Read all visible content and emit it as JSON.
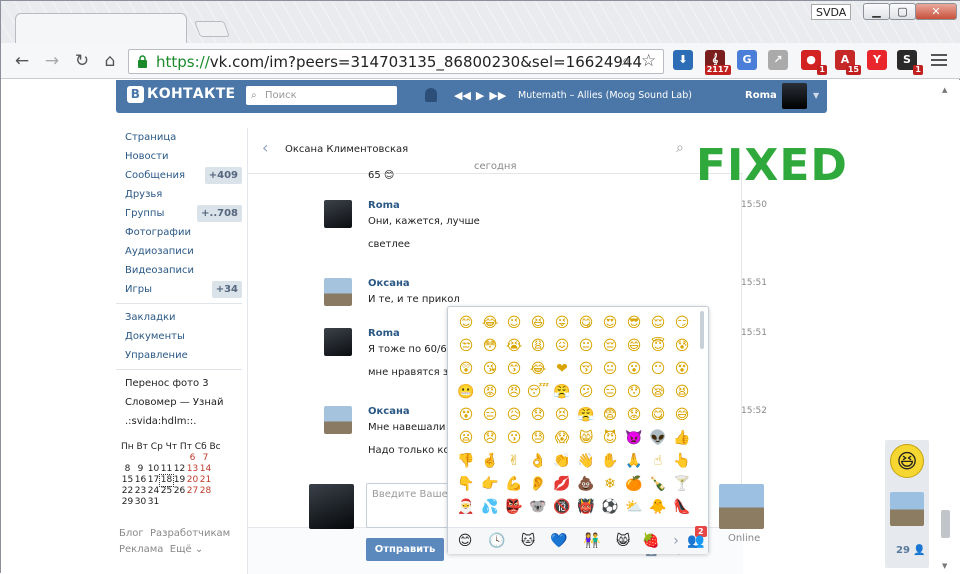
{
  "window": {
    "title": "SVDA",
    "min_label": "▁",
    "max_label": "▢",
    "close_label": "✕"
  },
  "browser": {
    "url_scheme": "https://",
    "url_rest": "vk.com/im?peers=314703135_86800230&sel=16624944",
    "extensions": [
      {
        "name": "download-ext",
        "label": "⬇",
        "color": "#2d6db5",
        "badge": ""
      },
      {
        "name": "music-ext",
        "label": "𝄞",
        "color": "#7a1d1d",
        "badge": "2117"
      },
      {
        "name": "translate-ext",
        "label": "G",
        "color": "#4a7ed8",
        "badge": ""
      },
      {
        "name": "share-ext",
        "label": "↗",
        "color": "#aaaaaa",
        "badge": ""
      },
      {
        "name": "adblock-ext",
        "label": "●",
        "color": "#d22222",
        "badge": "1"
      },
      {
        "name": "abp-ext",
        "label": "A",
        "color": "#c62828",
        "badge": "15"
      },
      {
        "name": "yandex-ext",
        "label": "Y",
        "color": "#e8262c",
        "badge": ""
      },
      {
        "name": "s-ext",
        "label": "S",
        "color": "#2a2a2a",
        "badge": "1"
      }
    ]
  },
  "vk": {
    "logo_b": "В",
    "logo_text": "КОНТАКТЕ",
    "search_placeholder": "Поиск",
    "track": "Mutemath – Allies (Moog Sound Lab)",
    "user": "Roma",
    "menu": [
      {
        "label": "Страница",
        "count": ""
      },
      {
        "label": "Новости",
        "count": ""
      },
      {
        "label": "Сообщения",
        "count": "+409"
      },
      {
        "label": "Друзья",
        "count": ""
      },
      {
        "label": "Группы",
        "count": "+..708"
      },
      {
        "label": "Фотографии",
        "count": ""
      },
      {
        "label": "Аудиозаписи",
        "count": ""
      },
      {
        "label": "Видеозаписи",
        "count": ""
      },
      {
        "label": "Игры",
        "count": "+34"
      }
    ],
    "menu2": [
      "Закладки",
      "Документы",
      "Управление"
    ],
    "menu3": [
      "Перенос фото 3",
      "Словомер — Узнай",
      ".:svida:hdlm::."
    ],
    "calendar": {
      "header": "Пн Вт Ср Чт Пт Сб Вс",
      "rows": [
        [
          "",
          "",
          "",
          "",
          "",
          "6",
          "7"
        ],
        [
          "8",
          "9",
          "10",
          "11",
          "12",
          "13",
          "14"
        ],
        [
          "15",
          "16",
          "17",
          "18",
          "19",
          "20",
          "21"
        ],
        [
          "22",
          "23",
          "24",
          "25",
          "26",
          "27",
          "28"
        ],
        [
          "29",
          "30",
          "31",
          "",
          "",
          "",
          ""
        ]
      ]
    },
    "footer": [
      "Блог",
      "Разработчикам",
      "Реклама",
      "Ещё ⌄"
    ]
  },
  "conversation": {
    "title": "Оксана Климентовская",
    "date_divider": "сегодня",
    "prev_tail": "65 😊",
    "messages": [
      {
        "author": "Roma",
        "time": "15:50",
        "lines": [
          "Они, кажется, лучше",
          "светлее"
        ]
      },
      {
        "author": "Оксана",
        "time": "15:51",
        "lines": [
          "И те, и те прикол"
        ]
      },
      {
        "author": "Roma",
        "time": "15:51",
        "lines": [
          "Я тоже по 60/65 п",
          "мне нравятся зел"
        ]
      },
      {
        "author": "Оксана",
        "time": "15:52",
        "lines": [
          "Мне навешали ла",
          "Надо только коти"
        ]
      }
    ],
    "input_placeholder": "Введите Ваше сообщение...",
    "send_label": "Отправить",
    "online_label": "Online",
    "more_label": "Ещё ⌄",
    "quick_emoji": [
      "😏",
      "😄",
      "👍",
      "😊",
      "🙈",
      "👫",
      "🎁"
    ]
  },
  "emoji_panel": {
    "rows": [
      [
        "😊",
        "😂",
        "😉",
        "😆",
        "😜",
        "😋",
        "😍",
        "😎",
        "😌",
        "😏"
      ],
      [
        "😒",
        "😳",
        "😭",
        "😩",
        "😖",
        "😐",
        "😔",
        "😄",
        "😇",
        "😰"
      ],
      [
        "😲",
        "😘",
        "😙",
        "😂",
        "❤",
        "😚",
        "😐",
        "😮",
        "😶",
        "😵"
      ],
      [
        "😬",
        "😡",
        "😠",
        "😴",
        "😤",
        "😕",
        "😑",
        "😯",
        "😪",
        "😫"
      ],
      [
        "😵",
        "😑",
        "😥",
        "😞",
        "😣",
        "😤",
        "😨",
        "😟",
        "😋",
        "😅"
      ],
      [
        "😦",
        "😞",
        "😗",
        "😓",
        "😱",
        "😸",
        "😈",
        "👿",
        "👽",
        "👍"
      ],
      [
        "👎",
        "🤞",
        "✌",
        "👌",
        "👏",
        "👋",
        "✋",
        "🙏",
        "☝",
        "👆"
      ],
      [
        "👇",
        "👉",
        "💪",
        "👂",
        "💋",
        "💩",
        "❄",
        "🍊",
        "🍾",
        "🍸"
      ],
      [
        "🎅",
        "💦",
        "👺",
        "🐨",
        "🔞",
        "👹",
        "⚽",
        "⛅",
        "🐥",
        "👠"
      ]
    ],
    "tabs": [
      "😊",
      "🕓",
      "🐱",
      "💙",
      "👫",
      "😸",
      "🍓",
      "›",
      "👥"
    ],
    "tab_badge": "2"
  },
  "annotation": "FIXED",
  "dock": {
    "count": "29 👤"
  }
}
